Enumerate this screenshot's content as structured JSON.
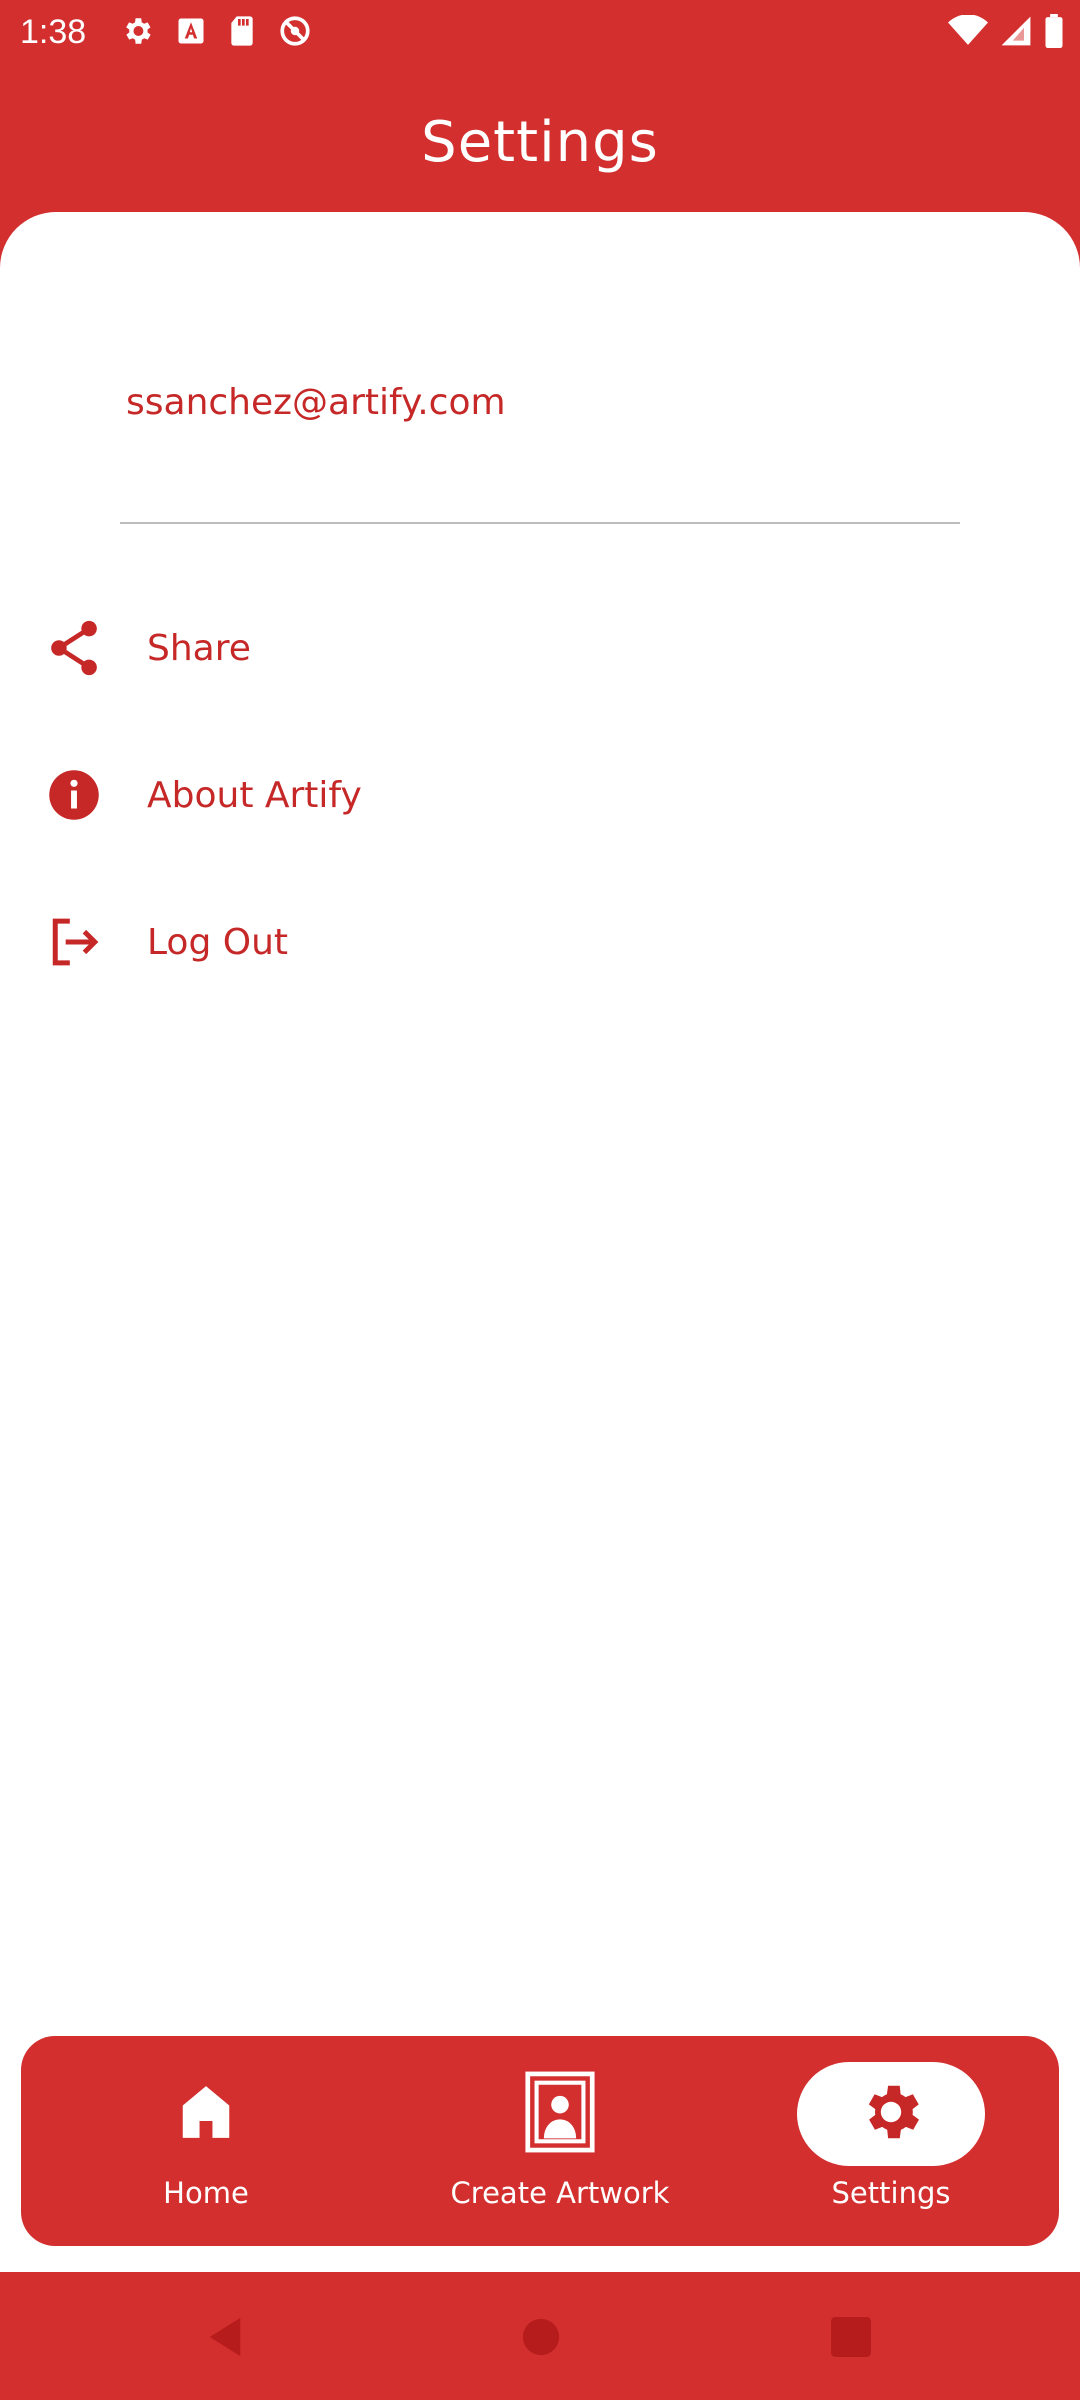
{
  "status_bar": {
    "time": "1:38",
    "left_icons": [
      "gear-icon",
      "font-a-icon",
      "sd-card-icon",
      "do-not-disturb-icon"
    ],
    "right_icons": [
      "wifi-icon",
      "cellular-signal-icon",
      "battery-icon"
    ]
  },
  "header": {
    "title": "Settings"
  },
  "account": {
    "email": "ssanchez@artify.com"
  },
  "menu": {
    "items": [
      {
        "label": "Share",
        "icon": "share-icon"
      },
      {
        "label": "About Artify",
        "icon": "info-icon"
      },
      {
        "label": "Log Out",
        "icon": "logout-icon"
      }
    ]
  },
  "bottom_nav": {
    "items": [
      {
        "label": "Home",
        "icon": "home-icon",
        "active": false
      },
      {
        "label": "Create Artwork",
        "icon": "portrait-frame-icon",
        "active": false
      },
      {
        "label": "Settings",
        "icon": "gear-icon",
        "active": true
      }
    ]
  },
  "system_nav": {
    "buttons": [
      "back-icon",
      "home-circle-icon",
      "recents-square-icon"
    ]
  },
  "colors": {
    "primary": "#d32f2f",
    "accent_text": "#c62828",
    "surface": "#ffffff",
    "divider": "#bdbdbd",
    "system_button": "#b71c1c"
  }
}
